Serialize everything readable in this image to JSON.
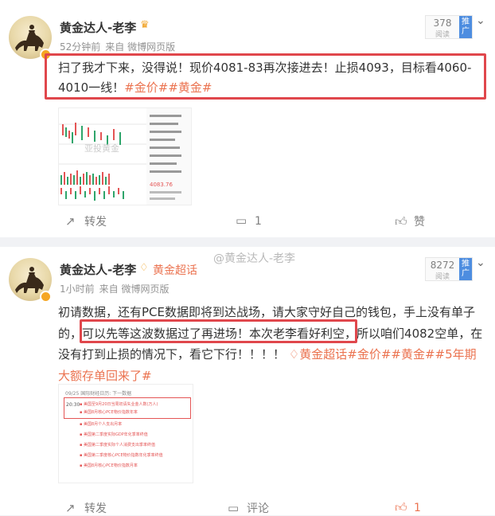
{
  "posts": [
    {
      "author": "黄金达人-老李",
      "time": "52分钟前",
      "source": "来自 微博网页版",
      "reads": "378",
      "reads_label": "阅读",
      "promote": "推广",
      "text": "扫了我才下来，没得说！现价4081-83再次接进去！止损4093，目标看4060-4010一线！",
      "tags": [
        "#金价#",
        "#黄金#"
      ],
      "image_watermark": "亚投黄金",
      "image_price": "4083.76",
      "actions": {
        "forward": "转发",
        "comment": "1",
        "like": "赞"
      }
    },
    {
      "author": "黄金达人-老李",
      "super_topic": "黄金超话",
      "time": "1小时前",
      "source": "来自 微博网页版",
      "reads": "8272",
      "reads_label": "阅读",
      "promote": "推广",
      "text_a": "初请数据，还有PCE数据即将到达战场，请大家守好自己的钱包，手上没有单子的，",
      "text_b": "可以先等这波数据过了再进场！本次老李看好利空，",
      "text_c": "所以咱们4082空单，在没有打到止损的情况下，看它下行！！！！",
      "tags": [
        "黄金超话",
        "#金价#",
        "#黄金#",
        "#5年期大额存单回来了#"
      ],
      "image_header": "09/25 国际财经日历: 下一数据",
      "image_rows": [
        "美国至9月20日当周初请失业金人数(万人)",
        "美国8月核心PCE物价指数年率",
        "美国8月个人支出月率",
        "美国第二季度实际GDP年化季率终值",
        "美国第二季度实际个人消费支出季率终值",
        "美国第二季度核心PCE物价指数年化季率终值",
        "美国8月核心PCE物价指数月率"
      ],
      "image_time": "20:30",
      "actions": {
        "forward": "转发",
        "comment": "评论",
        "like": "1"
      }
    }
  ],
  "watermark": "@黄金达人-老李"
}
